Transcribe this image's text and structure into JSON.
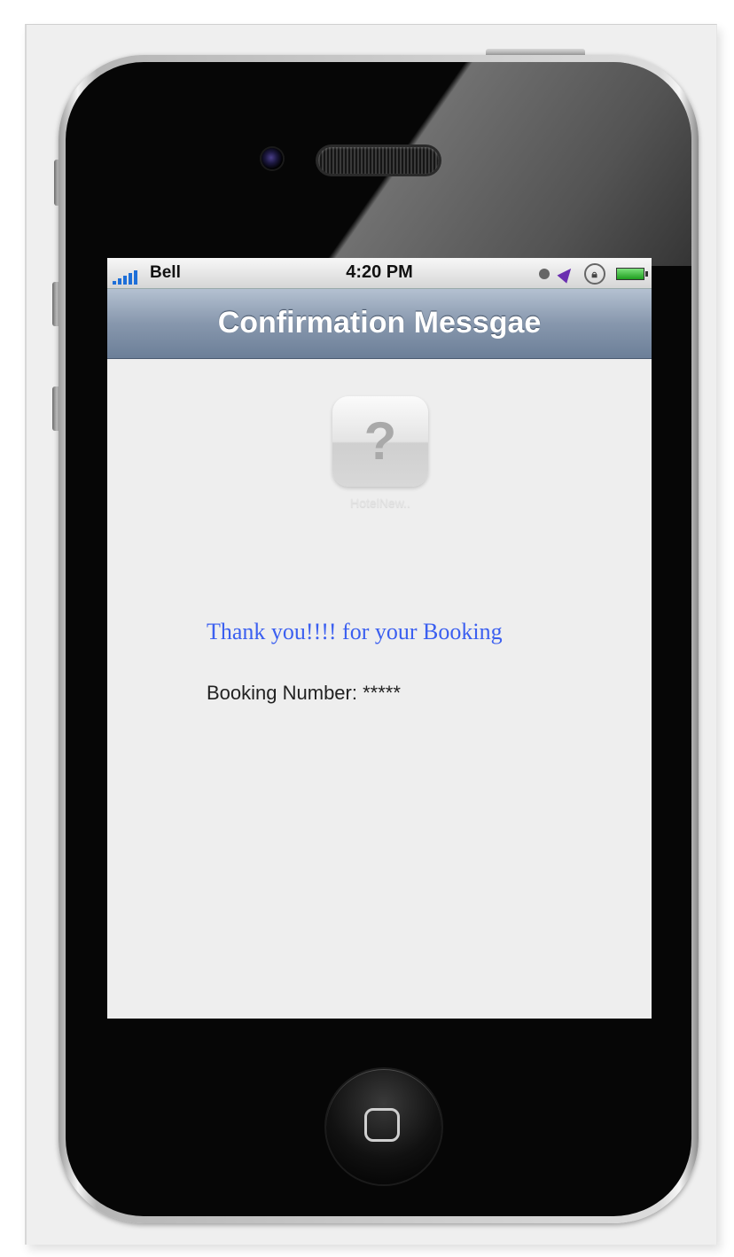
{
  "status_bar": {
    "carrier": "Bell",
    "time": "4:20 PM",
    "icons": [
      "signal-icon",
      "clock-icon",
      "location-icon",
      "rotation-lock-icon",
      "battery-icon"
    ]
  },
  "nav_bar": {
    "title": "Confirmation Messgae"
  },
  "app_icon": {
    "glyph": "?",
    "label": "HotelNew.."
  },
  "content": {
    "thank_you": "Thank you!!!! for your Booking",
    "booking_number": "Booking Number: *****"
  },
  "colors": {
    "nav_bar": "#8797ad",
    "thank_you_text": "#3b5ff0",
    "screen_background": "#eeeeee"
  }
}
